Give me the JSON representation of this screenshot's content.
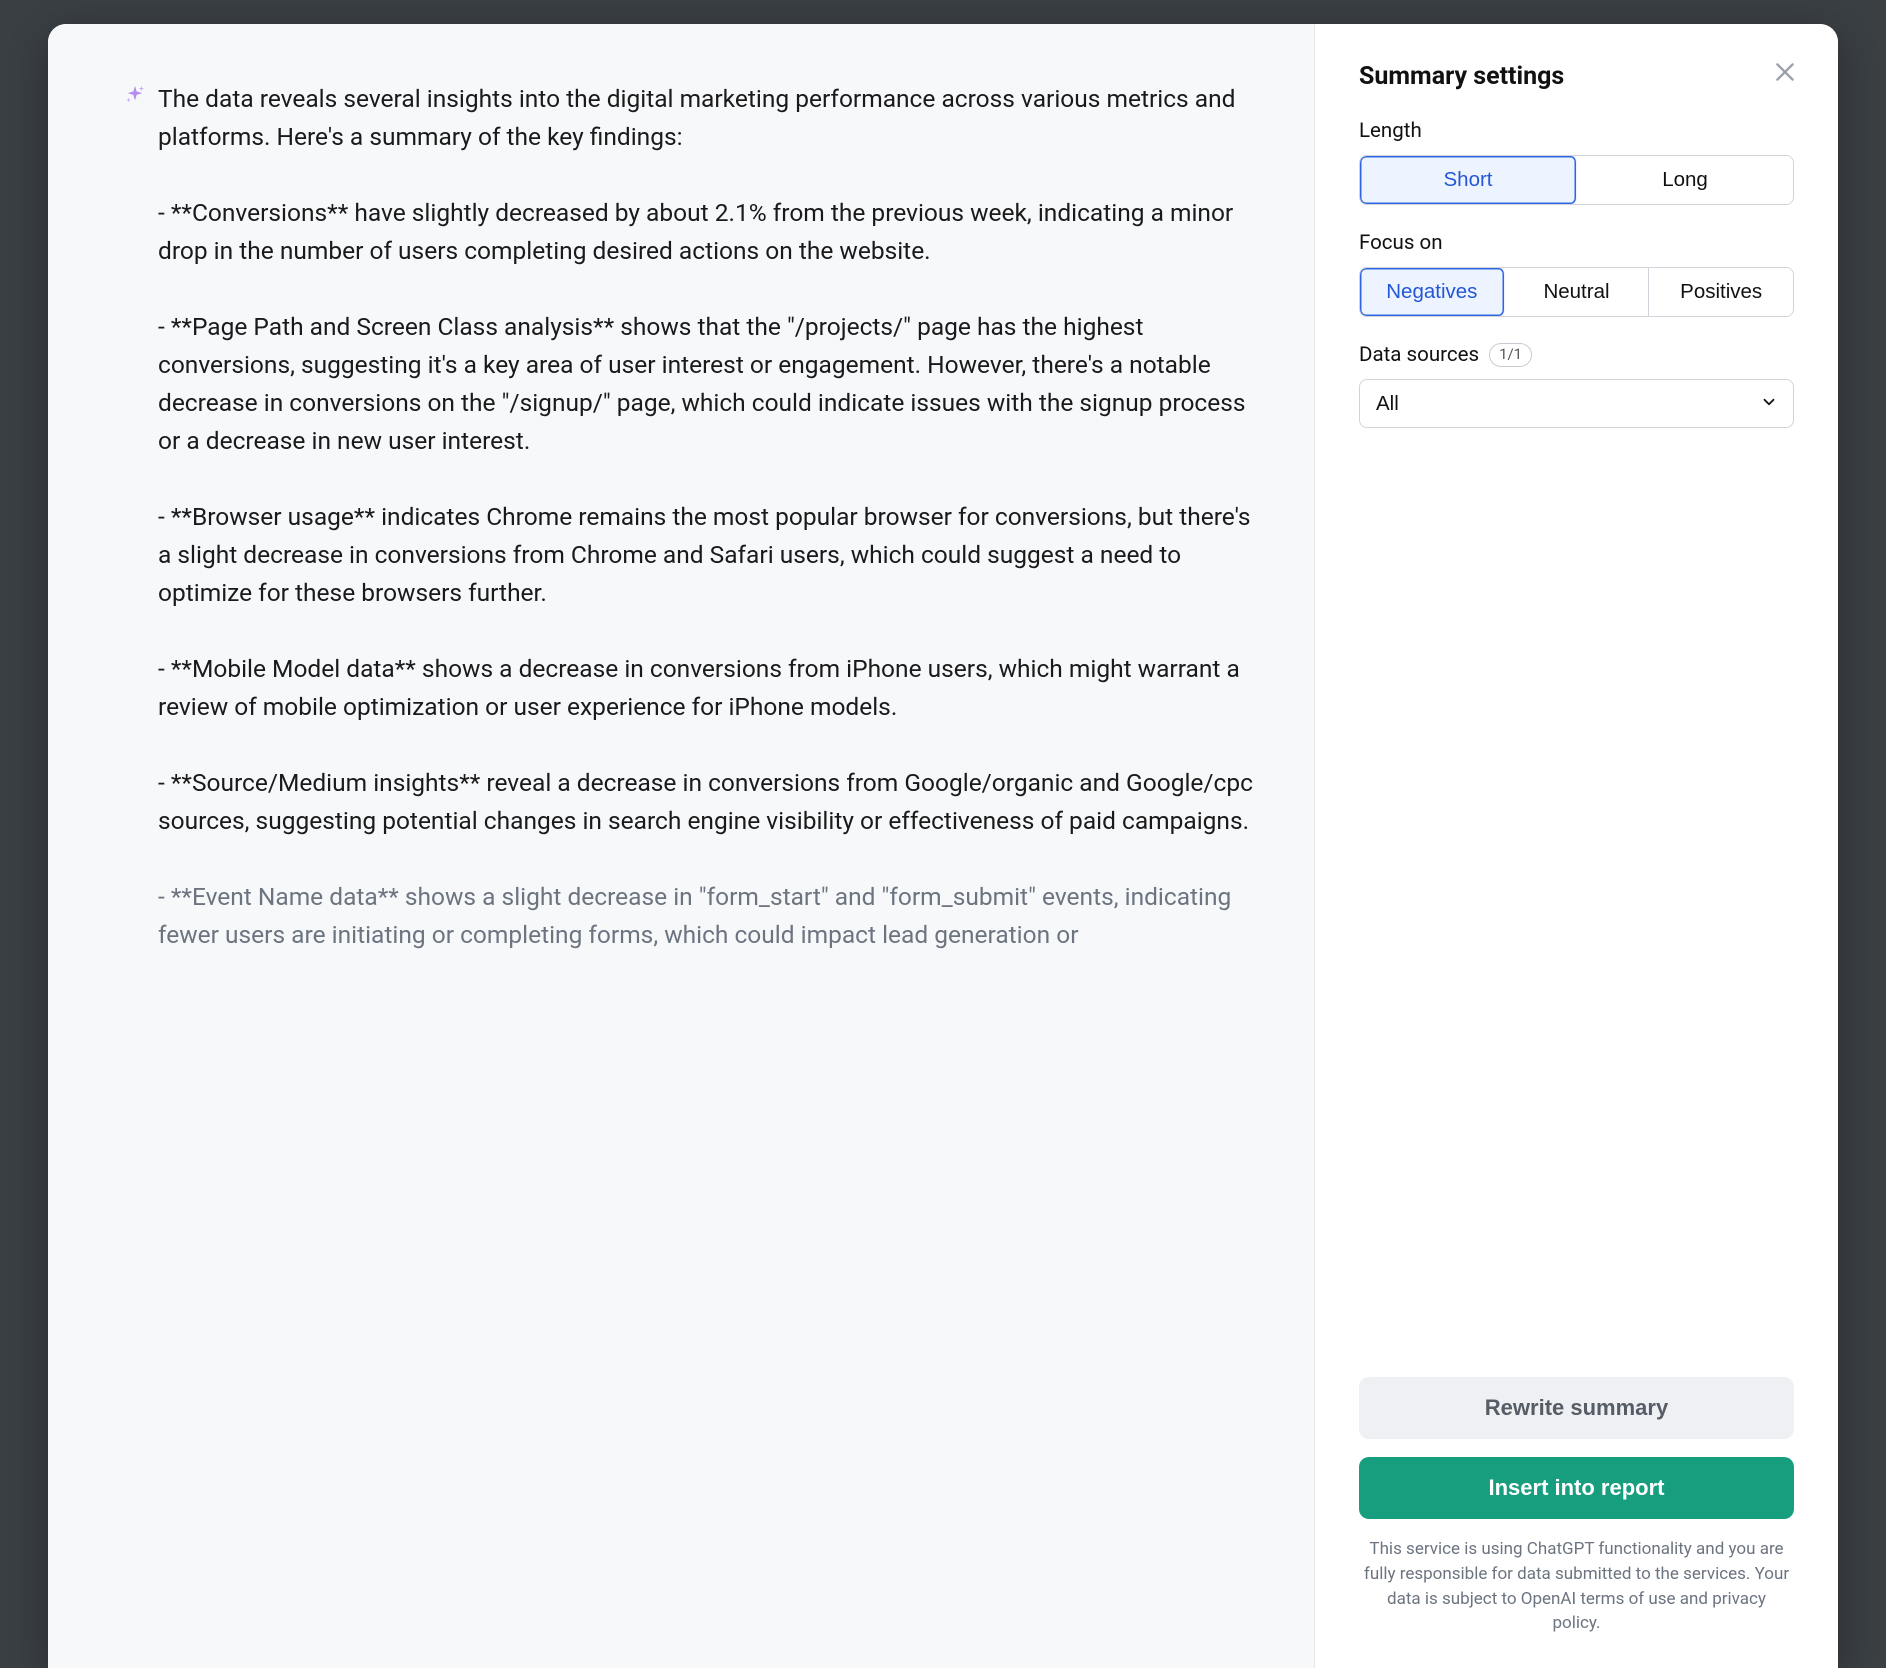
{
  "summary": {
    "intro": "The data reveals several insights into the digital marketing performance across various metrics and platforms. Here's a summary of the key findings:",
    "bullets": [
      "- **Conversions** have slightly decreased by about 2.1% from the previous week, indicating a minor drop in the number of users completing desired actions on the website.",
      "- **Page Path and Screen Class analysis** shows that the \"/projects/\" page has the highest conversions, suggesting it's a key area of user interest or engagement. However, there's a notable decrease in conversions on the \"/signup/\" page, which could indicate issues with the signup process or a decrease in new user interest.",
      "- **Browser usage** indicates Chrome remains the most popular browser for conversions, but there's a slight decrease in conversions from Chrome and Safari users, which could suggest a need to optimize for these browsers further.",
      "- **Mobile Model data** shows a decrease in conversions from iPhone users, which might warrant a review of mobile optimization or user experience for iPhone models.",
      "- **Source/Medium insights** reveal a decrease in conversions from Google/organic and Google/cpc sources, suggesting potential changes in search engine visibility or effectiveness of paid campaigns.",
      "- **Event Name data** shows a slight decrease in \"form_start\" and \"form_submit\" events, indicating fewer users are initiating or completing forms, which could impact lead generation or"
    ]
  },
  "settings": {
    "title": "Summary settings",
    "length_label": "Length",
    "length_options": {
      "short": "Short",
      "long": "Long"
    },
    "length_selected": "short",
    "focus_label": "Focus on",
    "focus_options": {
      "negatives": "Negatives",
      "neutral": "Neutral",
      "positives": "Positives"
    },
    "focus_selected": "negatives",
    "data_sources_label": "Data sources",
    "data_sources_count": "1/1",
    "data_sources_value": "All",
    "rewrite_label": "Rewrite summary",
    "insert_label": "Insert into report",
    "disclaimer": "This service is using ChatGPT functionality and you are fully responsible for data submitted to the services. Your data is subject to OpenAI terms of use and privacy policy."
  }
}
